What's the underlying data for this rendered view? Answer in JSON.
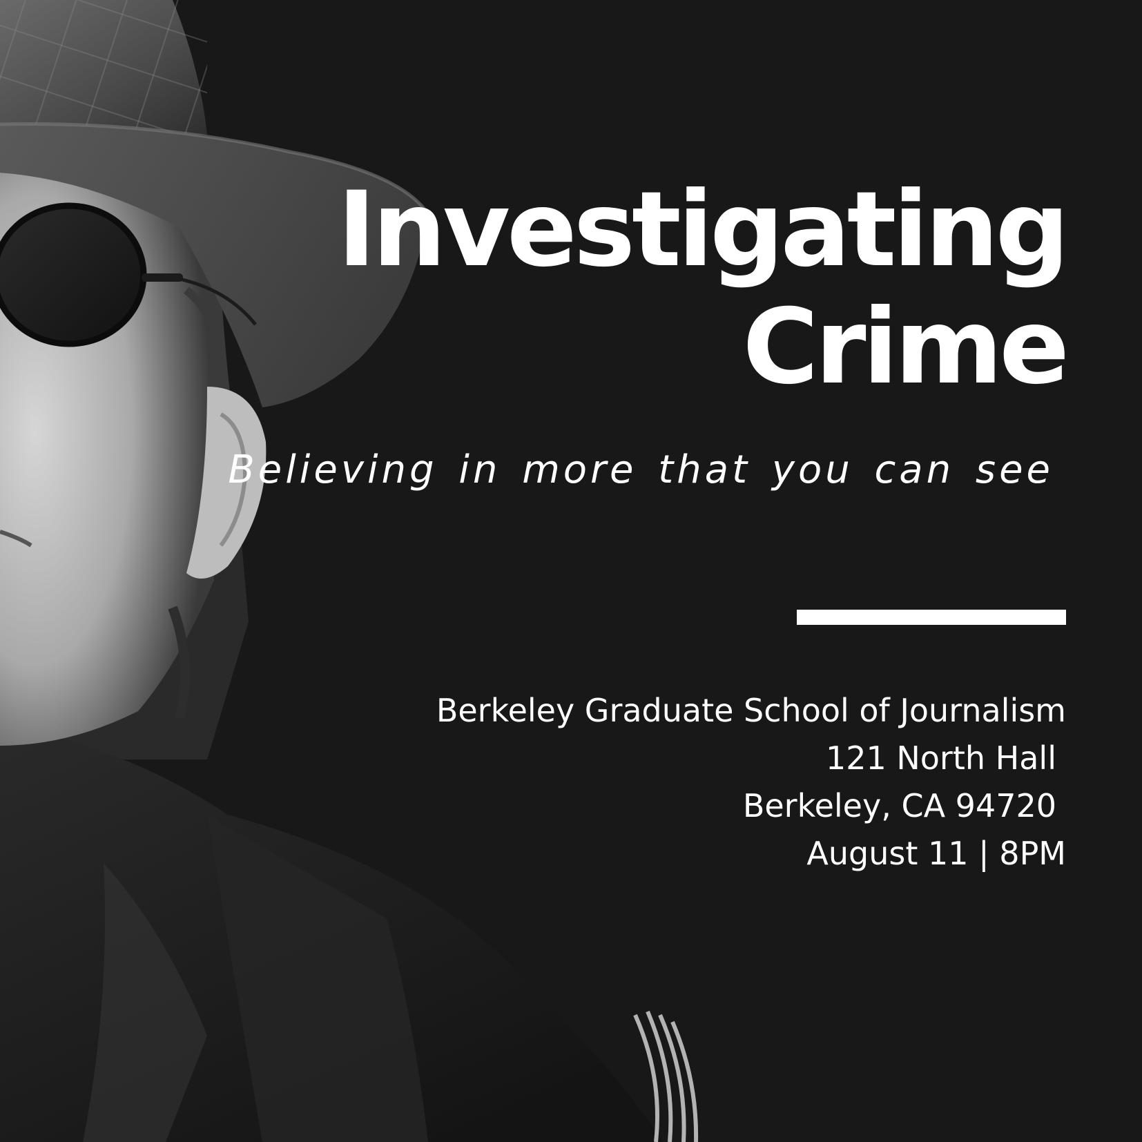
{
  "poster": {
    "title_line1": "Investigating",
    "title_line2": "Crime",
    "tagline": "Believing in more that you can see",
    "details": {
      "school": "Berkeley Graduate School of Journalism",
      "address1": "121 North Hall",
      "address2": "Berkeley, CA 94720",
      "datetime": "August 11 | 8PM"
    }
  },
  "colors": {
    "background": "#181818",
    "text": "#ffffff",
    "divider": "#ffffff"
  },
  "photo": {
    "subject": "person-in-fedora-and-round-sunglasses-icon"
  }
}
